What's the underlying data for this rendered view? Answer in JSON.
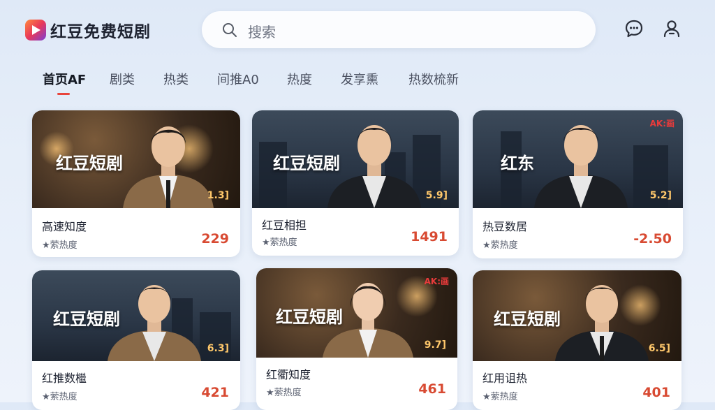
{
  "app": {
    "name": "红豆免费短剧"
  },
  "search": {
    "placeholder": "搜索"
  },
  "header": {
    "icons": [
      "chat-icon",
      "user-icon"
    ]
  },
  "tabs": [
    {
      "label": "首页AF",
      "active": true
    },
    {
      "label": "剧类",
      "active": false
    },
    {
      "label": "热类",
      "active": false
    },
    {
      "label": "间推A0",
      "active": false
    },
    {
      "label": "热度",
      "active": false
    },
    {
      "label": "发享熏",
      "active": false
    },
    {
      "label": "热数梳新",
      "active": false
    }
  ],
  "cards": [
    {
      "thumb_title": "红豆短剧",
      "score": "1.3]",
      "title": "高速知度",
      "meta": "★萦热度",
      "num": "229",
      "brand": ""
    },
    {
      "thumb_title": "红豆短剧",
      "score": "5.9]",
      "title": "红豆相担",
      "meta": "★萦热度",
      "num": "1491",
      "brand": ""
    },
    {
      "thumb_title": "红东",
      "score": "5.2]",
      "title": "热豆数居",
      "meta": "★萦热度",
      "num": "-2.50",
      "brand": "AK:画"
    },
    {
      "thumb_title": "红豆短剧",
      "score": "6.3]",
      "title": "红推数檵",
      "meta": "★萦热度",
      "num": "421",
      "brand": ""
    },
    {
      "thumb_title": "红豆短剧",
      "score": "9.7]",
      "title": "红衢知度",
      "meta": "★萦热度",
      "num": "461",
      "brand": "AK:画"
    },
    {
      "thumb_title": "红豆短剧",
      "score": "6.5]",
      "title": "红用诅热",
      "meta": "★萦热度",
      "num": "401",
      "brand": ""
    }
  ],
  "colors": {
    "accent": "#e8453c",
    "number": "#d84a32",
    "score": "#ffc86b"
  }
}
